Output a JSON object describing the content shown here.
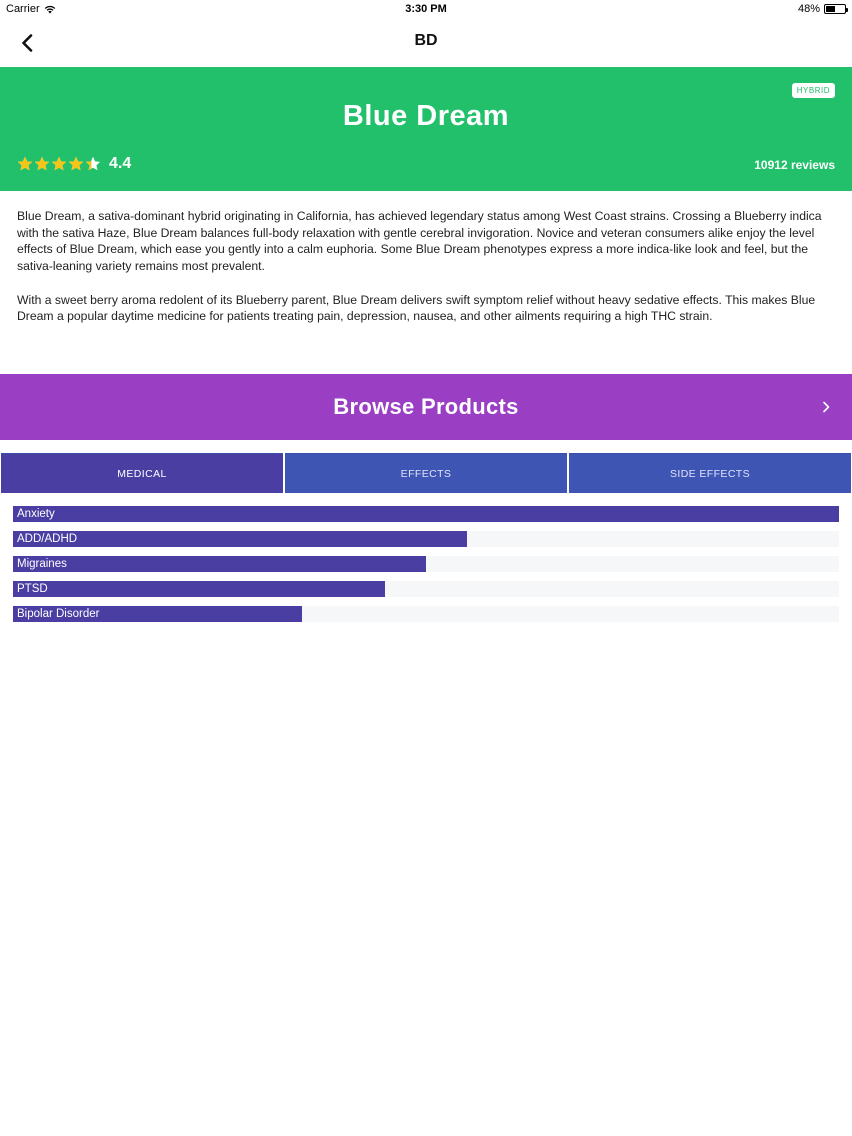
{
  "status_bar": {
    "carrier": "Carrier",
    "time": "3:30 PM",
    "battery": "48%",
    "battery_level": 0.48,
    "icons": [
      "wifi-icon",
      "battery-icon"
    ]
  },
  "nav": {
    "title": "BD",
    "back_icon": "chevron-left-icon"
  },
  "strain": {
    "name": "Blue Dream",
    "type_badge": "HYBRID",
    "rating": "4.4",
    "rating_value": 4.4,
    "reviews": "10912 reviews"
  },
  "description": {
    "paragraphs": [
      "Blue Dream, a sativa-dominant hybrid originating in California, has achieved legendary status among West Coast strains. Crossing a Blueberry indica with the sativa Haze, Blue Dream balances full-body relaxation with gentle cerebral invigoration. Novice and veteran consumers alike enjoy the level effects of Blue Dream, which ease you gently into a calm euphoria. Some Blue Dream phenotypes express a more indica-like look and feel, but the sativa-leaning variety remains most prevalent.",
      "With a sweet berry aroma redolent of its Blueberry parent, Blue Dream delivers swift symptom relief without heavy sedative effects. This makes Blue Dream a popular daytime medicine for patients treating pain, depression, nausea, and other ailments requiring a high THC strain."
    ]
  },
  "browse": {
    "label": "Browse Products",
    "icon": "chevron-right-icon"
  },
  "tabs": [
    {
      "label": "MEDICAL",
      "active": true
    },
    {
      "label": "EFFECTS",
      "active": false
    },
    {
      "label": "SIDE EFFECTS",
      "active": false
    }
  ],
  "medical_bars": [
    {
      "label": "Anxiety",
      "value": 1.0
    },
    {
      "label": "ADD/ADHD",
      "value": 0.55
    },
    {
      "label": "Migraines",
      "value": 0.5
    },
    {
      "label": "PTSD",
      "value": 0.45
    },
    {
      "label": "Bipolar Disorder",
      "value": 0.35
    }
  ],
  "colors": {
    "header_green": "#22c06b",
    "browse_purple": "#9a3ec4",
    "tab_active": "#4a3ea3",
    "tab_inactive": "#3f55b3",
    "bar_fill": "#4a3ea3",
    "star": "#f5c518"
  }
}
